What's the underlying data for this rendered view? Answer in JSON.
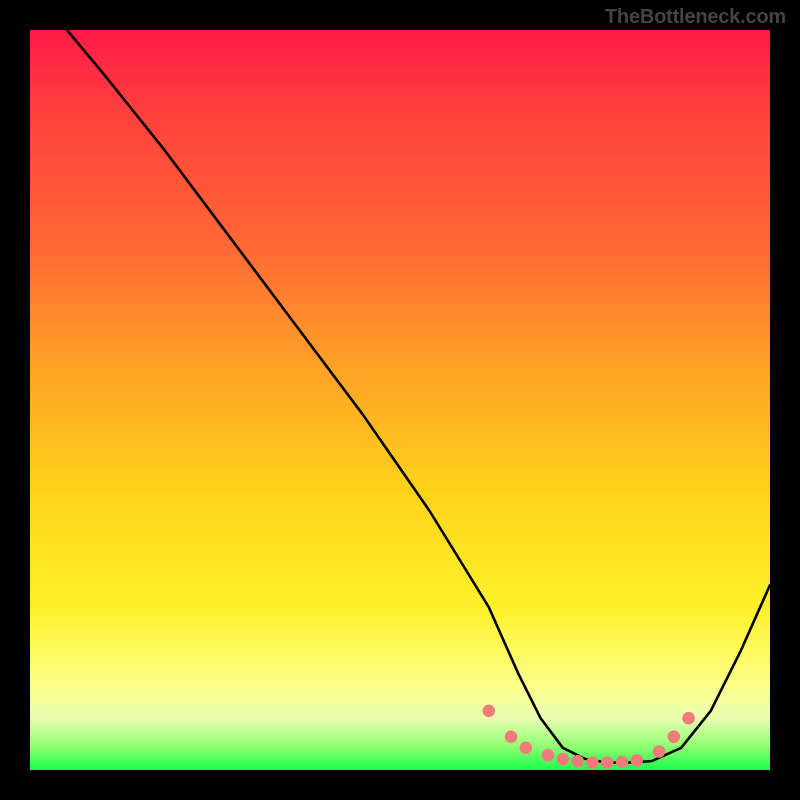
{
  "watermark": "TheBottleneck.com",
  "chart_data": {
    "type": "line",
    "title": "",
    "xlabel": "",
    "ylabel": "",
    "xlim": [
      0,
      100
    ],
    "ylim": [
      0,
      100
    ],
    "series": [
      {
        "name": "curve",
        "x": [
          5,
          10,
          18,
          27,
          36,
          45,
          54,
          62,
          66,
          69,
          72,
          75,
          78,
          81,
          84,
          88,
          92,
          96,
          100
        ],
        "y": [
          100,
          94,
          84,
          72,
          60,
          48,
          35,
          22,
          13,
          7,
          3,
          1.5,
          1,
          1,
          1.2,
          3,
          8,
          16,
          25
        ]
      }
    ],
    "highlight_points": {
      "name": "trough-dots",
      "color": "#f07b7b",
      "x": [
        62,
        65,
        67,
        70,
        72,
        74,
        76,
        78,
        80,
        82,
        85,
        87,
        89
      ],
      "y": [
        8,
        4.5,
        3,
        2,
        1.5,
        1.2,
        1,
        1,
        1.1,
        1.3,
        2.5,
        4.5,
        7
      ]
    }
  }
}
